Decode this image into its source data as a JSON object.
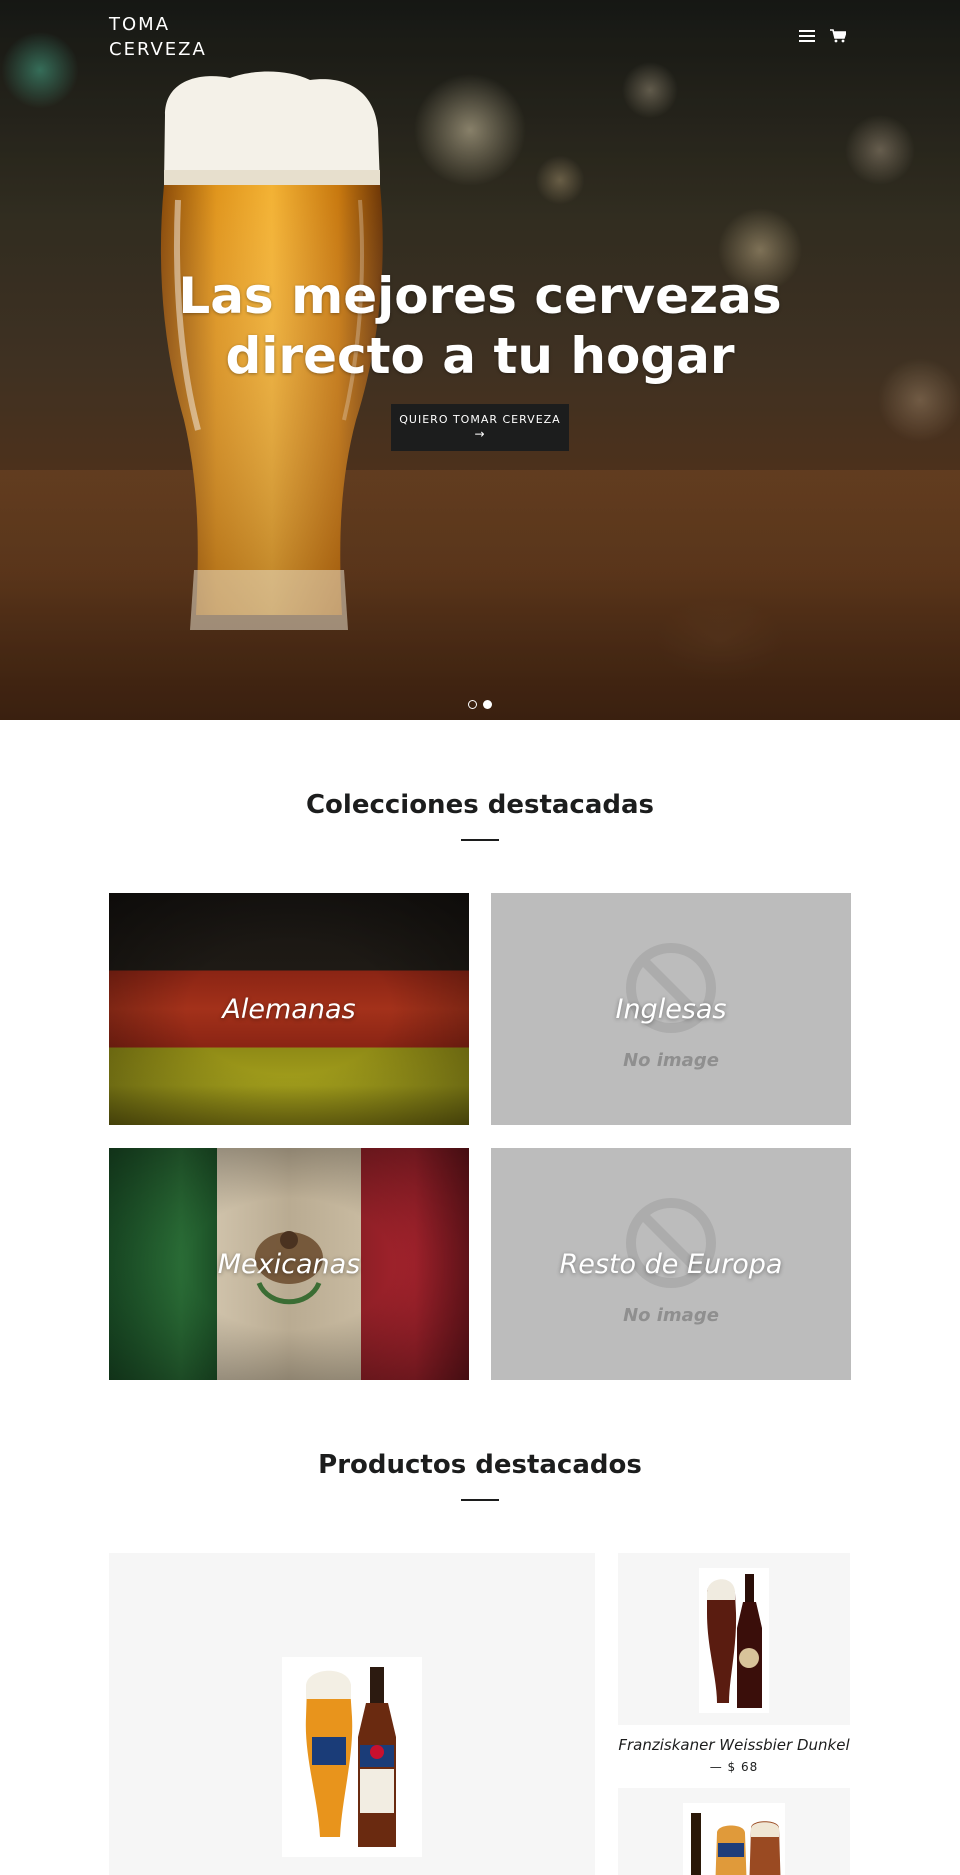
{
  "header": {
    "logo": "TOMA CERVEZA",
    "menu_icon": "hamburger-menu-icon",
    "cart_icon": "shopping-cart-icon"
  },
  "hero": {
    "title": "Las mejores cervezas directo a tu hogar",
    "button_label": "QUIERO TOMAR CERVEZA",
    "button_arrow": "→",
    "slides": 2,
    "active_slide": 2
  },
  "collections": {
    "title": "Colecciones destacadas",
    "items": [
      {
        "label": "Alemanas",
        "image": "germany-flag"
      },
      {
        "label": "Inglesas",
        "image": "no-image",
        "placeholder": "No image"
      },
      {
        "label": "Mexicanas",
        "image": "mexico-flag"
      },
      {
        "label": "Resto de Europa",
        "image": "no-image",
        "placeholder": "No image"
      }
    ]
  },
  "products": {
    "title": "Productos destacados",
    "items": [
      {
        "name": "",
        "image": "erdinger-beer"
      },
      {
        "name": "Franziskaner Weissbier Dunkel",
        "price": "— $ 68",
        "image": "franziskaner-beer"
      },
      {
        "name": "",
        "image": "hofbrau-beer"
      }
    ]
  },
  "colors": {
    "text": "#1c1d1d",
    "button": "#1c1d1d",
    "placeholder_bg": "#bcbcbc",
    "product_bg": "#f6f6f6"
  }
}
